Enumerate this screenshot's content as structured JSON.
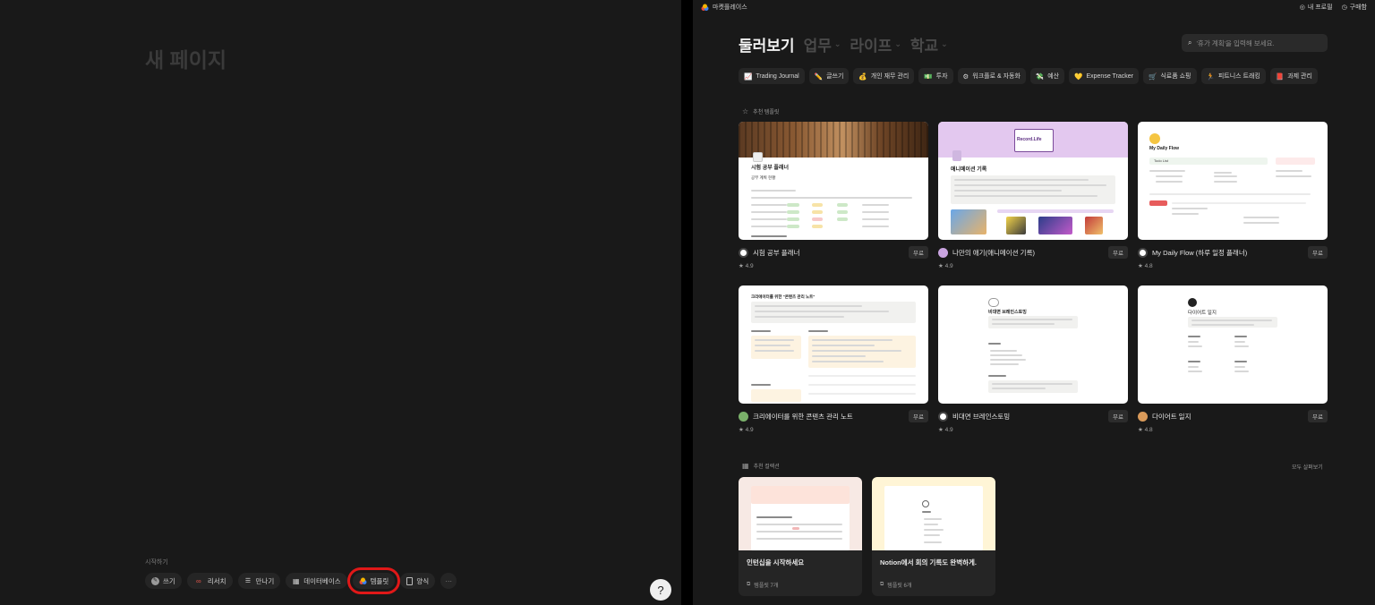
{
  "left": {
    "page_title": "새 페이지",
    "start_label": "시작하기",
    "start_items": [
      {
        "label": "쓰기",
        "icon": "pen-icon"
      },
      {
        "label": "리서치",
        "icon": "infinity-icon"
      },
      {
        "label": "만나기",
        "icon": "meeting-icon"
      },
      {
        "label": "데이터베이스",
        "icon": "table-icon"
      },
      {
        "label": "템플릿",
        "icon": "template-icon"
      },
      {
        "label": "양식",
        "icon": "form-icon"
      },
      {
        "label": "⋯",
        "icon": "more-icon"
      }
    ],
    "help_glyph": "?"
  },
  "right": {
    "topbar": {
      "brand": "마켓플레이스",
      "profile": "내 프로필",
      "purchases": "구매함"
    },
    "categories": [
      "둘러보기",
      "업무",
      "라이프",
      "학교"
    ],
    "search_placeholder": "'휴가 계획'을 입력해 보세요.",
    "tags": [
      {
        "label": "Trading Journal",
        "icon": "📈"
      },
      {
        "label": "글쓰기",
        "icon": "✏️"
      },
      {
        "label": "개인 재무 관리",
        "icon": "💰"
      },
      {
        "label": "투자",
        "icon": "💵"
      },
      {
        "label": "워크플로 & 자동화",
        "icon": "⚙"
      },
      {
        "label": "예산",
        "icon": "💸"
      },
      {
        "label": "Expense Tracker",
        "icon": "💛"
      },
      {
        "label": "식료품 쇼핑",
        "icon": "🛒"
      },
      {
        "label": "피트니스 트래킹",
        "icon": "🏃"
      },
      {
        "label": "과제 관리",
        "icon": "📕"
      }
    ],
    "recommended_templates_label": "추천 템플릿",
    "templates": [
      {
        "name": "시험 공부 플래너",
        "price": "무료",
        "rating": "★ 4.9",
        "thumb_title": "시험 공부 플래너",
        "thumb_sub": "공부 계획 현황"
      },
      {
        "name": "나만의 애기(애니메이션 기록)",
        "price": "무료",
        "rating": "★ 4.9",
        "thumb_title": "애니메이션 기록",
        "thumb_sub": "Record.Life"
      },
      {
        "name": "My Daily Flow (하루 일정 플래너)",
        "price": "무료",
        "rating": "★ 4.8",
        "thumb_title": "My Daily Flow",
        "thumb_sub": "Todo List"
      },
      {
        "name": "크리에이터를 위한 콘텐츠 관리 노트",
        "price": "무료",
        "rating": "★ 4.9",
        "thumb_title": "크리에이터를 위한 \"콘텐츠 관리 노트\"",
        "thumb_sub": ""
      },
      {
        "name": "비대면 브레인스토밍",
        "price": "무료",
        "rating": "★ 4.9",
        "thumb_title": "비대면 브레인스토밍",
        "thumb_sub": ""
      },
      {
        "name": "다이어트 일지",
        "price": "무료",
        "rating": "★ 4.8",
        "thumb_title": "다이어트 일지",
        "thumb_sub": ""
      }
    ],
    "recommended_collections_label": "추천 컬렉션",
    "see_all": "모두 살펴보기",
    "collections": [
      {
        "title": "인턴십을 시작하세요",
        "count": "템플릿 7개"
      },
      {
        "title": "Notion에서 회의 기록도 완벽하게.",
        "count": "템플릿 6개"
      }
    ]
  },
  "colors": {
    "bg": "#191919",
    "chip_bg": "#252525",
    "highlight": "#e01818",
    "accent_purple": "#e3c8ef",
    "accent_cream": "#fff5d6"
  }
}
